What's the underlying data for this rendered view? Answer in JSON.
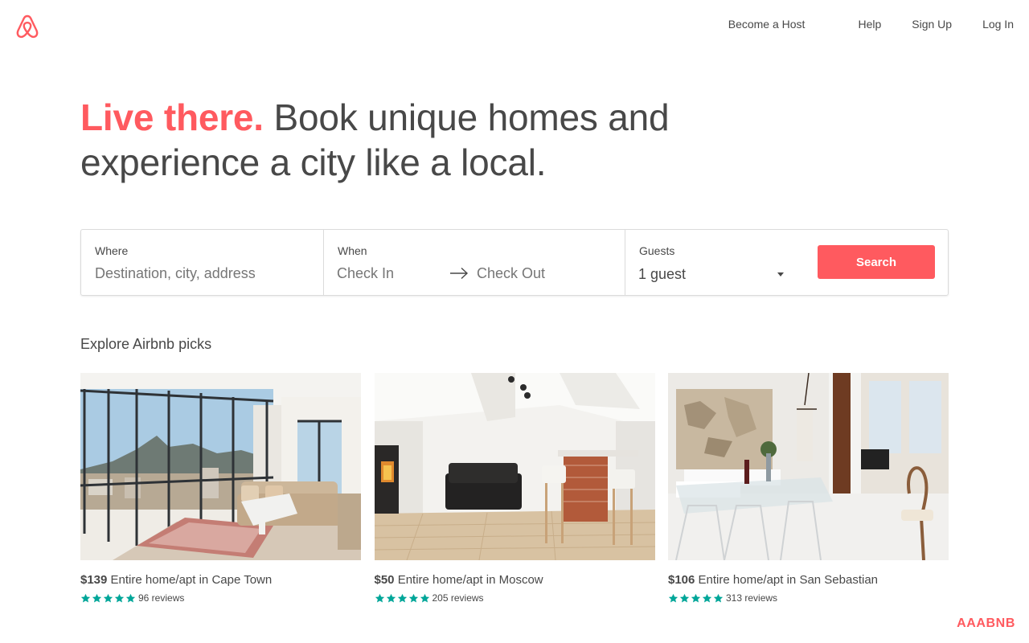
{
  "brand": {
    "accent": "#FF5A5F",
    "star_color": "#00A699"
  },
  "nav": {
    "become_host": "Become a Host",
    "help": "Help",
    "sign_up": "Sign Up",
    "log_in": "Log In"
  },
  "hero": {
    "accent_text": "Live there.",
    "line_rest": " Book unique homes and",
    "line2": "experience a city like a local."
  },
  "search": {
    "where_label": "Where",
    "where_placeholder": "Destination, city, address",
    "when_label": "When",
    "check_in": "Check In",
    "check_out": "Check Out",
    "guests_label": "Guests",
    "guests_value": "1 guest",
    "button": "Search"
  },
  "explore_title": "Explore Airbnb picks",
  "listings": [
    {
      "price": "$139",
      "desc": " Entire home/apt in Cape Town",
      "stars": 5,
      "reviews": "96 reviews"
    },
    {
      "price": "$50",
      "desc": " Entire home/apt in Moscow",
      "stars": 5,
      "reviews": "205 reviews"
    },
    {
      "price": "$106",
      "desc": " Entire home/apt in San Sebastian",
      "stars": 5,
      "reviews": "313 reviews"
    }
  ],
  "watermark": "AAABNB"
}
